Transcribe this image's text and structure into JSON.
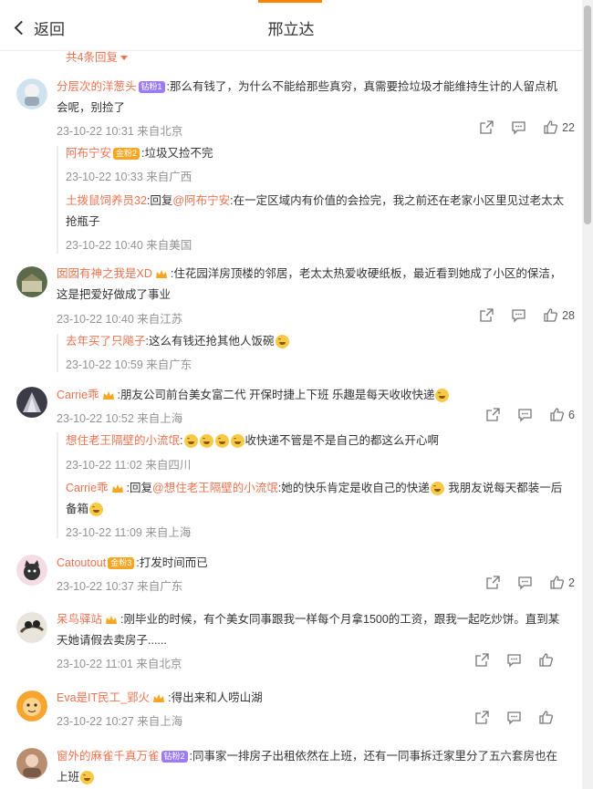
{
  "header": {
    "back_label": "返回",
    "title": "邢立达"
  },
  "more_replies": "共4条回复",
  "comments": [
    {
      "user": "分层次的洋葱头",
      "badge": "钻粉1",
      "text": ":那么有钱了，为什么不能给那些真穷，真需要捡垃圾才能维持生计的人留点机会呢，别捡了",
      "meta": "23-10-22 10:31 来自北京",
      "likes": "22",
      "replies": [
        {
          "user": "阿布宁安",
          "badge": "金粉2",
          "text": ":垃圾又捡不完",
          "meta": "23-10-22 10:33 来自广西"
        },
        {
          "user": "土拨鼠饲养员32",
          "prefix": ":回复",
          "mention": "@阿布宁安",
          "text": ":在一定区域内有价值的会捡完，我之前还在老家小区里见过老太太抢瓶子",
          "meta": "23-10-22 10:40 来自美国"
        }
      ]
    },
    {
      "user": "囡囡有神之我是XD",
      "text": ":住花园洋房顶楼的邻居，老太太热爱收硬纸板，最近看到她成了小区的保洁，这是把爱好做成了事业",
      "meta": "23-10-22 10:40 来自江苏",
      "likes": "28",
      "replies": [
        {
          "user": "去年买了只飚子",
          "text": ":这么有钱还抢其他人饭碗",
          "meta": "23-10-22 10:59 来自广东"
        }
      ]
    },
    {
      "user": "Carrie乖",
      "text": ":朋友公司前台美女富二代  开保时捷上下班   乐趣是每天收收快递",
      "meta": "23-10-22 10:52 来自上海",
      "likes": "6",
      "replies": [
        {
          "user": "想住老王隔壁的小流氓",
          "text": "收快递不管是不是自己的都这么开心啊",
          "meta": "23-10-22 11:02 来自四川"
        },
        {
          "user": "Carrie乖",
          "prefix": ":回复",
          "mention": "@想住老王隔壁的小流氓",
          "text": ":她的快乐肯定是收自己的快递",
          "text2": "我朋友说每天都装一后备箱",
          "meta": "23-10-22 11:09 来自上海"
        }
      ]
    },
    {
      "user": "Catoutout",
      "badge": "金粉3",
      "text": ":打发时间而已",
      "meta": "23-10-22 10:37 来自广东",
      "likes": "2"
    },
    {
      "user": "呆鸟驿站",
      "text": ":刚毕业的时候，有个美女同事跟我一样每个月拿1500的工资，跟我一起吃炒饼。直到某天她请假去卖房子......",
      "meta": "23-10-22 11:01 来自北京"
    },
    {
      "user": "Eva是IT民工_郢火",
      "text": ":得出来和人唠山湖",
      "meta": "23-10-22 10:27 来自上海"
    },
    {
      "user": "窗外的麻雀千真万雀",
      "badge": "钻粉2",
      "text": ":同事家一排房子出租依然在上班，还有一同事拆迁家里分了五六套房也在上班"
    }
  ],
  "colors": {
    "accent": "#ff8200",
    "username": "#eb7350",
    "meta": "#939393"
  },
  "icons": [
    "back-chevron-icon",
    "share-icon",
    "comment-icon",
    "like-icon",
    "crown-icon",
    "laugh-emoji-icon"
  ]
}
